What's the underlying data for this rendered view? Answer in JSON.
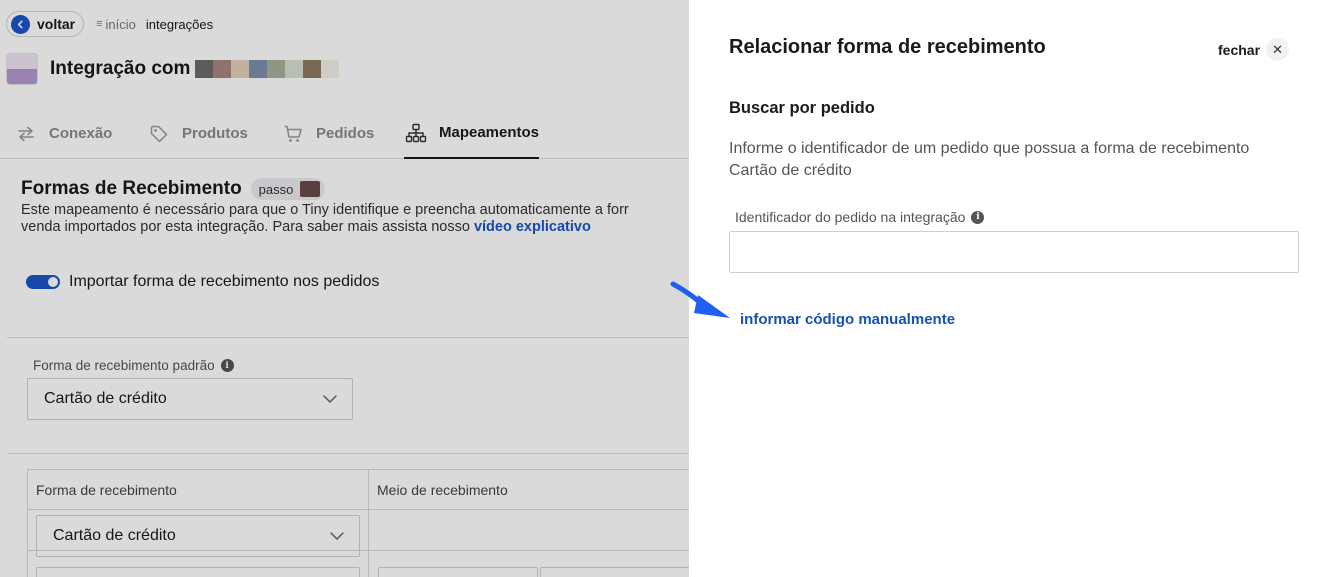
{
  "breadcrumb": {
    "back_label": "voltar",
    "home_label": "início",
    "current_label": "integrações"
  },
  "header": {
    "title": "Integração com",
    "redacted_colors": [
      "#6f6b70",
      "#a8867f",
      "#e3cfb6",
      "#7e8fab",
      "#a6b199",
      "#d8dfd0",
      "#8e7a61"
    ]
  },
  "tabs": [
    {
      "label": "Conexão",
      "icon": "arrows-exchange-icon"
    },
    {
      "label": "Produtos",
      "icon": "tag-icon"
    },
    {
      "label": "Pedidos",
      "icon": "cart-icon"
    },
    {
      "label": "Mapeamentos",
      "icon": "sitemap-icon",
      "active": true
    }
  ],
  "section": {
    "title": "Formas de Recebimento",
    "step_label": "passo",
    "desc_line1": "Este mapeamento é necessário para que o Tiny identifique e preencha automaticamente a forr",
    "desc_line2_prefix": "venda importados por esta integração. Para saber mais assista nosso ",
    "desc_link": "vídeo explicativo"
  },
  "toggle": {
    "label": "Importar forma de recebimento nos pedidos",
    "checked": true
  },
  "default_payment": {
    "label": "Forma de recebimento padrão",
    "value": "Cartão de crédito"
  },
  "table": {
    "headers": [
      "Forma de recebimento",
      "Meio de recebimento"
    ],
    "rows": [
      {
        "forma": "Cartão de crédito",
        "meio": ""
      }
    ]
  },
  "panel": {
    "title": "Relacionar forma de recebimento",
    "close_label": "fechar",
    "subtitle": "Buscar por pedido",
    "description": "Informe o identificador de um pedido que possua a forma de recebimento Cartão de crédito",
    "field_label": "Identificador do pedido na integração",
    "field_value": "",
    "manual_link": "informar código manualmente"
  },
  "colors": {
    "accent": "#1a56c8",
    "link": "#1553b3",
    "annotation_arrow": "#1f5ff2"
  }
}
